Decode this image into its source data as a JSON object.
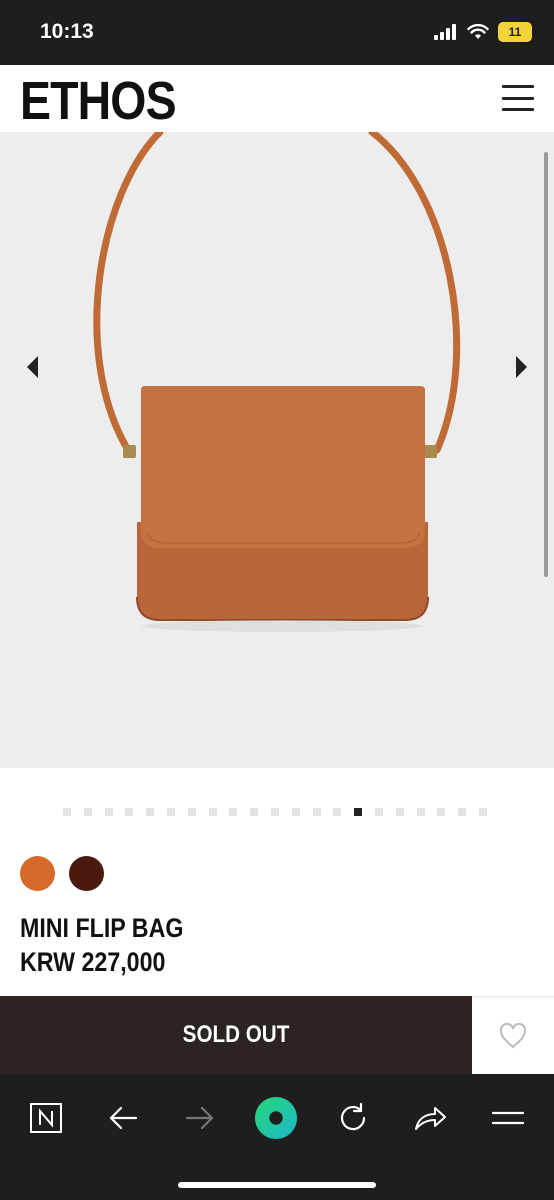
{
  "status_bar": {
    "time": "10:13",
    "battery_level": "11",
    "icons": [
      "cellular-signal-icon",
      "wifi-icon",
      "battery-icon"
    ]
  },
  "header": {
    "logo": "ETHOS",
    "menu_icon": "hamburger-menu-icon"
  },
  "gallery": {
    "total_slides": 21,
    "active_slide_index": 14,
    "prev_icon": "chevron-left-icon",
    "next_icon": "chevron-right-icon"
  },
  "product": {
    "name": "MINI FLIP BAG",
    "price": "KRW 227,000",
    "colors": [
      {
        "name": "tan",
        "hex": "#d56a2a"
      },
      {
        "name": "brown",
        "hex": "#4a1a0c"
      }
    ]
  },
  "actions": {
    "sold_out_label": "SOLD OUT",
    "wishlist_icon": "heart-icon"
  },
  "browser_toolbar": {
    "items": [
      "naver-home-icon",
      "back-arrow-icon",
      "forward-arrow-icon",
      "green-dot-icon",
      "reload-icon",
      "share-icon",
      "menu-icon"
    ]
  },
  "colors": {
    "dark_bar": "#2c2421",
    "status_bg": "#1e1e1e",
    "image_bg": "#ededed"
  }
}
